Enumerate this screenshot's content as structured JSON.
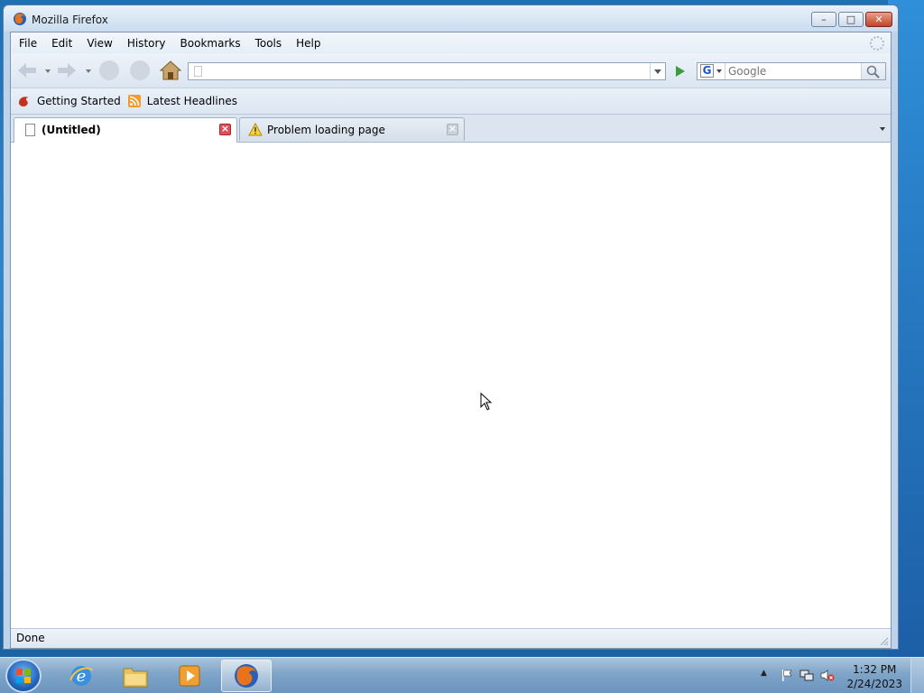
{
  "window": {
    "title": "Mozilla Firefox",
    "controls": {
      "minimize": "–",
      "maximize": "□",
      "close": "✕"
    }
  },
  "menubar": {
    "items": [
      "File",
      "Edit",
      "View",
      "History",
      "Bookmarks",
      "Tools",
      "Help"
    ]
  },
  "navbar": {
    "url_value": "",
    "search_engine": "G",
    "search_placeholder": "Google"
  },
  "bookmarks": {
    "items": [
      {
        "label": "Getting Started",
        "icon": "firefox-logo-icon"
      },
      {
        "label": "Latest Headlines",
        "icon": "rss-feed-icon"
      }
    ]
  },
  "tabs": [
    {
      "label": "(Untitled)",
      "active": true,
      "icon": "blank-page-icon"
    },
    {
      "label": "Problem loading page",
      "active": false,
      "icon": "warning-icon"
    }
  ],
  "status": {
    "text": "Done"
  },
  "taskbar": {
    "clock_time": "1:32 PM",
    "clock_date": "2/24/2023",
    "tray_overflow": "▲"
  },
  "colors": {
    "close_button": "#c2432a",
    "tab_close_active": "#e0505a",
    "go_arrow": "#3d9d3d",
    "taskbar": "#7ea4c8"
  }
}
